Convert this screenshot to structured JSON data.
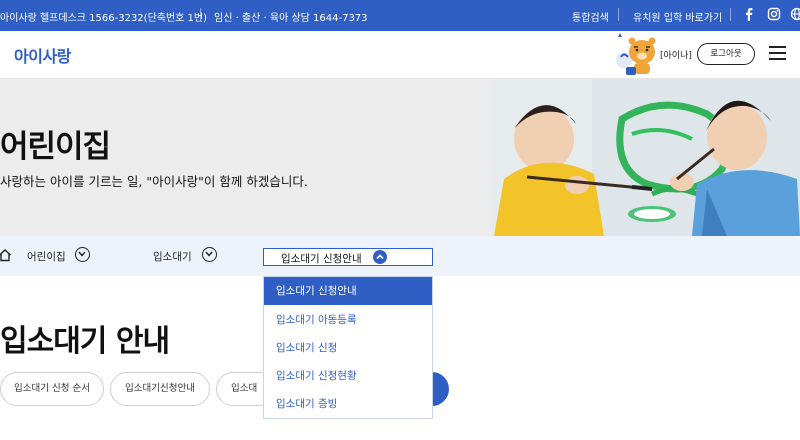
{
  "topbar": {
    "helpdesk": "아이사랑 헬프데스크 1566-3232(단축번호 1번)",
    "counsel": "임신 · 출산 · 육아 상담 1644-7373",
    "search": "통합검색",
    "kinder_link": "유치원 입학 바로가기",
    "icons": [
      "facebook-icon",
      "instagram-icon",
      "globe-icon"
    ]
  },
  "header": {
    "logo": "아이사랑",
    "user_label": "[아이나]",
    "logout_label": "로그아웃"
  },
  "hero": {
    "title": "어린이집",
    "subtitle": "사랑하는 아이를 기르는 일, \"아이사랑\"이 함께 하겠습니다."
  },
  "locnav": {
    "level1": "어린이집",
    "level2": "입소대기",
    "level3": "입소대기 신청안내"
  },
  "dropdown": {
    "items": [
      "입소대기 신청안내",
      "입소대기 아동등록",
      "입소대기 신청",
      "입소대기 신청현황",
      "입소대기 증빙"
    ],
    "selected_index": 0
  },
  "page": {
    "title": "입소대기 안내",
    "tabs": [
      "입소대기 신청 순서",
      "입소대기신청안내",
      "입소대"
    ]
  },
  "colors": {
    "primary": "#2f5fc4",
    "hero_bg": "#ececec",
    "nav_bg": "#eef2fb"
  }
}
